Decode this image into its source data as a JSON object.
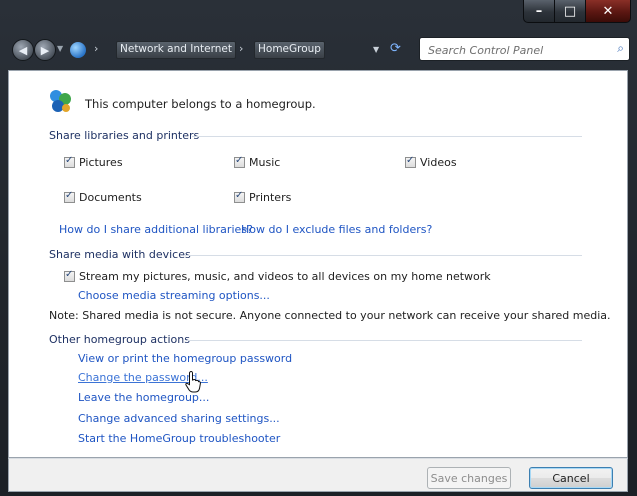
{
  "window": {
    "controls": {
      "minimize": "–",
      "maximize": "□",
      "close": "✕"
    }
  },
  "address_bar": {
    "breadcrumbs": [
      "Network and Internet",
      "HomeGroup"
    ],
    "search_placeholder": "Search Control Panel"
  },
  "header": {
    "icon": "homegroup-icon",
    "text": "This computer belongs to a homegroup."
  },
  "share_libraries": {
    "heading": "Share libraries and printers",
    "items": [
      {
        "label": "Pictures",
        "checked": true
      },
      {
        "label": "Music",
        "checked": true
      },
      {
        "label": "Videos",
        "checked": true
      },
      {
        "label": "Documents",
        "checked": true
      },
      {
        "label": "Printers",
        "checked": true
      }
    ],
    "links": [
      "How do I share additional libraries?",
      "How do I exclude files and folders?"
    ]
  },
  "share_media": {
    "heading": "Share media with devices",
    "stream_label": "Stream my pictures, music, and videos to all devices on my home network",
    "stream_checked": true,
    "options_link": "Choose media streaming options...",
    "note": "Note: Shared media is not secure. Anyone connected to your network can receive your shared media."
  },
  "actions": {
    "heading": "Other homegroup actions",
    "links": [
      "View or print the homegroup password",
      "Change the password...",
      "Leave the homegroup...",
      "Change advanced sharing settings...",
      "Start the HomeGroup troubleshooter"
    ]
  },
  "footer": {
    "save_label": "Save changes",
    "save_enabled": false,
    "cancel_label": "Cancel"
  }
}
